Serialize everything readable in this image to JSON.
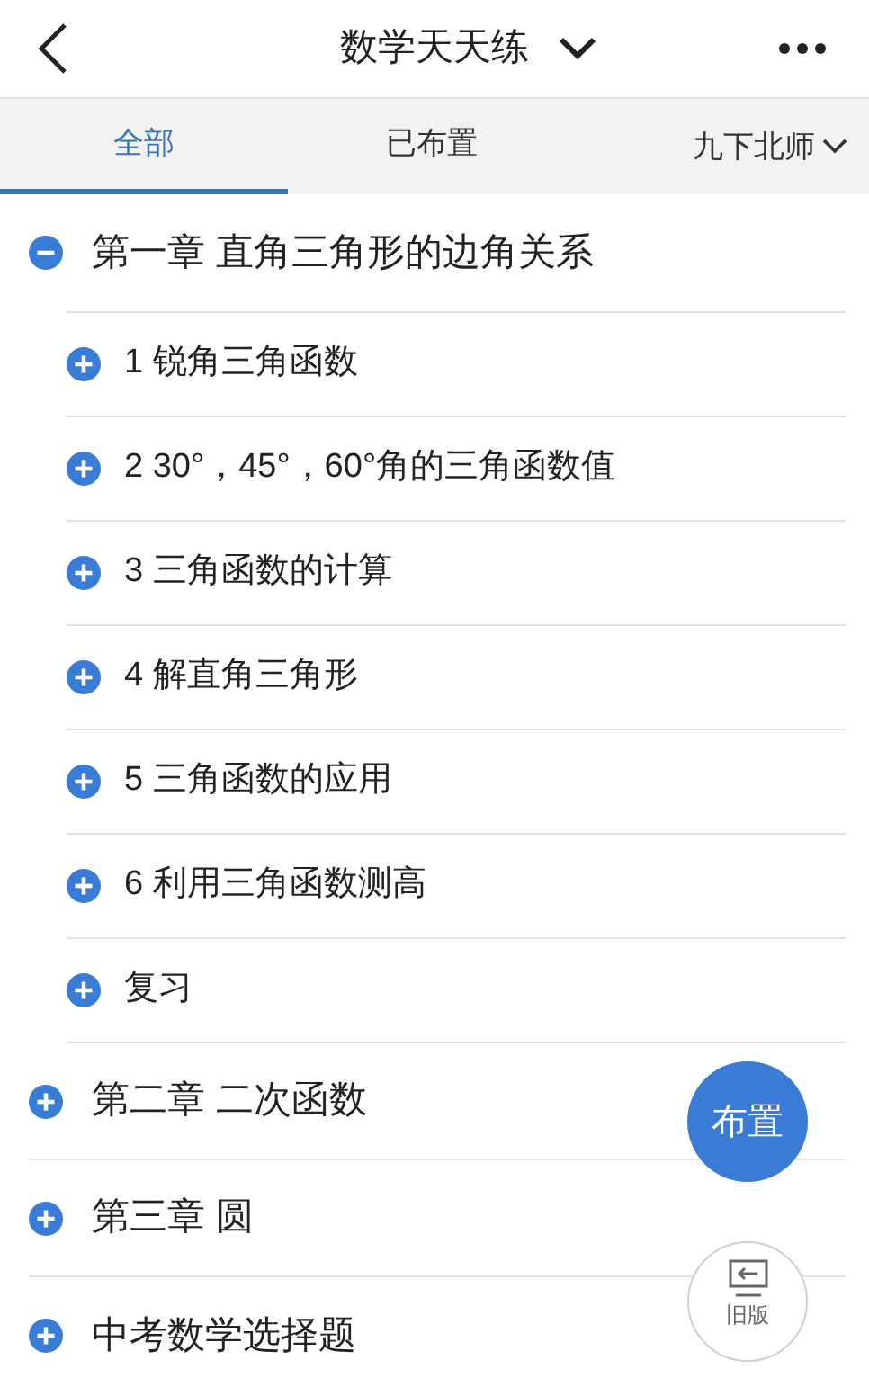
{
  "header": {
    "title": "数学天天练"
  },
  "tabs": [
    {
      "label": "全部",
      "selected": true
    },
    {
      "label": "已布置",
      "selected": false
    }
  ],
  "book_selector": {
    "label": "九下北师"
  },
  "chapters": [
    {
      "title": "第一章 直角三角形的边角关系",
      "expanded": true,
      "children": [
        {
          "title": "1 锐角三角函数",
          "expanded": false
        },
        {
          "title": "2 30°，45°，60°角的三角函数值",
          "expanded": false
        },
        {
          "title": "3 三角函数的计算",
          "expanded": false
        },
        {
          "title": "4 解直角三角形",
          "expanded": false
        },
        {
          "title": "5 三角函数的应用",
          "expanded": false
        },
        {
          "title": "6 利用三角函数测高",
          "expanded": false
        },
        {
          "title": "复习",
          "expanded": false
        }
      ]
    },
    {
      "title": "第二章 二次函数",
      "expanded": false
    },
    {
      "title": "第三章 圆",
      "expanded": false
    },
    {
      "title": "中考数学选择题",
      "expanded": false
    }
  ],
  "assign_button": {
    "label": "布置"
  },
  "old_version_button": {
    "label": "旧版"
  }
}
